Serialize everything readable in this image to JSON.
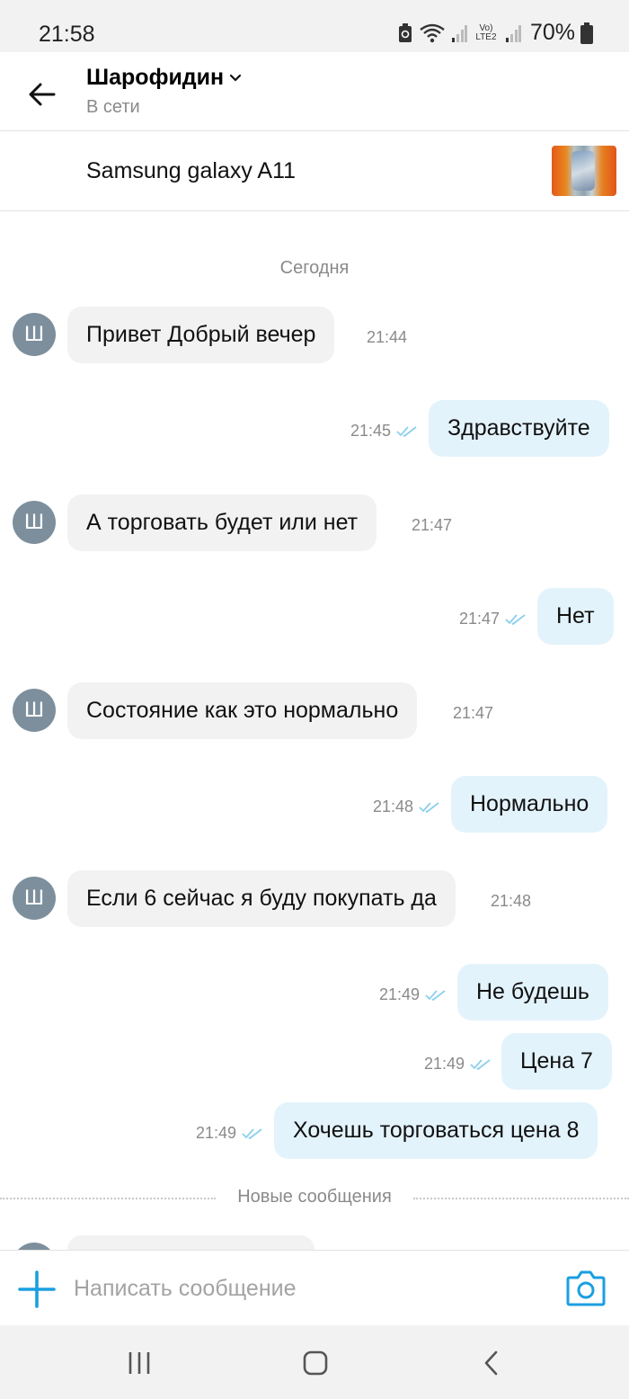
{
  "status_bar": {
    "time": "21:58",
    "network_label": "Vo) LTE2",
    "battery_percent": "70%"
  },
  "header": {
    "contact_name": "Шарофидин",
    "contact_status": "В сети"
  },
  "item": {
    "title": "Samsung galaxy A11"
  },
  "chat": {
    "date_label": "Сегодня",
    "new_messages_label": "Новые сообщения",
    "avatar_letter": "Ш",
    "messages": [
      {
        "direction": "in",
        "text": "Привет Добрый вечер",
        "time": "21:44"
      },
      {
        "direction": "out",
        "text": "Здравствуйте",
        "time": "21:45",
        "read": true
      },
      {
        "direction": "in",
        "text": "А торговать будет или нет",
        "time": "21:47"
      },
      {
        "direction": "out",
        "text": "Нет",
        "time": "21:47",
        "read": true
      },
      {
        "direction": "in",
        "text": "Состояние как это нормально",
        "time": "21:47"
      },
      {
        "direction": "out",
        "text": "Нормально",
        "time": "21:48",
        "read": true
      },
      {
        "direction": "in",
        "text": "Если 6 сейчас я буду покупать да",
        "time": "21:48"
      },
      {
        "direction": "out",
        "text": "Не будешь",
        "time": "21:49",
        "read": true
      },
      {
        "direction": "out",
        "text": "Цена 7",
        "time": "21:49",
        "read": true
      },
      {
        "direction": "out",
        "text": "Хочешь торговаться цена 8",
        "time": "21:49",
        "read": true
      }
    ]
  },
  "composer": {
    "placeholder": "Написать сообщение"
  },
  "colors": {
    "accent": "#1a9fe0",
    "incoming_bubble": "#f2f2f2",
    "outgoing_bubble": "#e3f3fc",
    "read_check": "#8ccfee",
    "avatar": "#7d8f9c"
  }
}
